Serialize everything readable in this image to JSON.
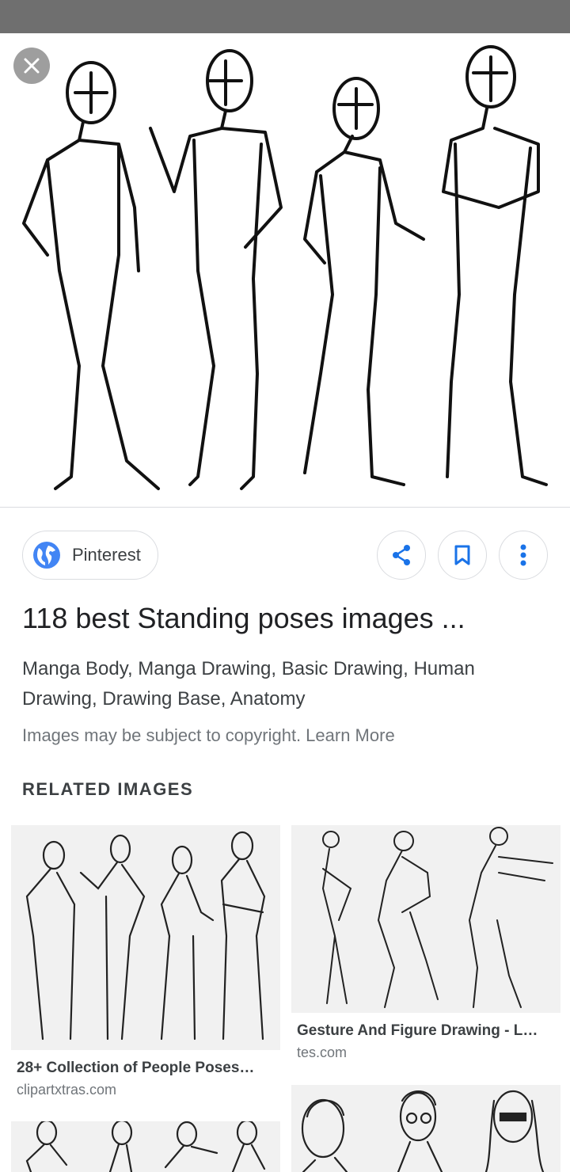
{
  "hero": {
    "alt": "standing poses figure drawing"
  },
  "close": {
    "icon": "close-icon"
  },
  "source": {
    "label": "Pinterest",
    "icon": "globe-icon"
  },
  "actions": {
    "share_icon": "share-icon",
    "save_icon": "bookmark-icon",
    "more_icon": "more-vert-icon"
  },
  "result": {
    "title": "118 best Standing poses images ...",
    "tags": "Manga Body, Manga Drawing, Basic Drawing, Human Drawing, Drawing Base, Anatomy",
    "copyright": "Images may be subject to copyright.",
    "learn_more": "Learn More"
  },
  "related": {
    "heading": "RELATED IMAGES",
    "items": [
      {
        "title": "28+ Collection of People Poses…",
        "source": "clipartxtras.com"
      },
      {
        "title": "Gesture And Figure Drawing - L…",
        "source": "tes.com"
      }
    ]
  },
  "colors": {
    "accent": "#4285f4",
    "text": "#202124",
    "muted": "#70757a",
    "border": "#dadce0"
  }
}
